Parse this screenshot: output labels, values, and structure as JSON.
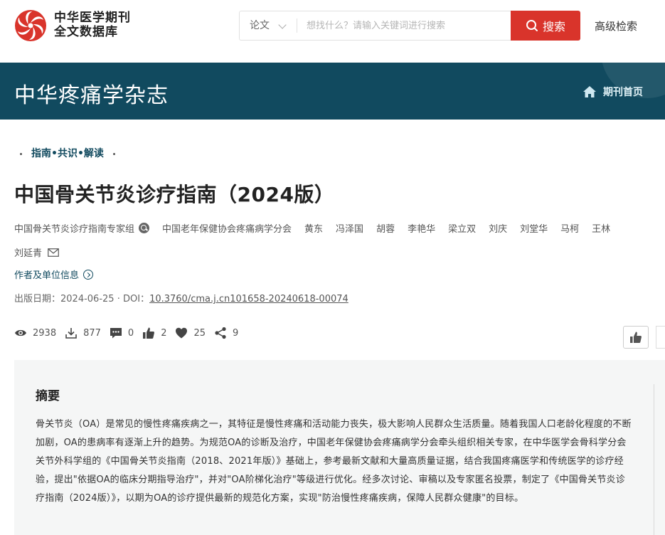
{
  "header": {
    "logo_line1": "中华医学期刊",
    "logo_line2": "全文数据库",
    "search_type": "论文",
    "search_placeholder": "想找什么？请输入关键词进行搜索",
    "search_button": "搜索",
    "advanced_search": "高级检索",
    "brand_color": "#d9342b"
  },
  "banner": {
    "journal_title": "中华疼痛学杂志",
    "home_link": "期刊首页",
    "bg_color": "#114a5f"
  },
  "article": {
    "category": "指南•共识•解读",
    "title": "中国骨关节炎诊疗指南（2024版）",
    "author_group": "中国骨关节炎诊疗指南专家组",
    "authors": [
      "中国老年保健协会疼痛病学分会",
      "黄东",
      "冯泽国",
      "胡蓉",
      "李艳华",
      "梁立双",
      "刘庆",
      "刘堂华",
      "马柯",
      "王林"
    ],
    "corresponding_author": "刘延青",
    "affiliation_link": "作者及单位信息",
    "pub_date_label": "出版日期：",
    "pub_date": "2024-06-25",
    "doi_label": " · DOI：",
    "doi": "10.3760/cma.j.cn101658-20240618-00074",
    "stats": {
      "views": "2938",
      "downloads": "877",
      "comments": "0",
      "likes": "2",
      "favorites": "25",
      "shares": "9"
    }
  },
  "abstract": {
    "heading": "摘要",
    "text": "骨关节炎（OA）是常见的慢性疼痛疾病之一，其特征是慢性疼痛和活动能力丧失，极大影响人民群众生活质量。随着我国人口老龄化程度的不断加剧，OA的患病率有逐渐上升的趋势。为规范OA的诊断及治疗，中国老年保健协会疼痛病学分会牵头组织相关专家，在中华医学会骨科学分会关节外科学组的《中国骨关节炎指南（2018、2021年版）》基础上，参考最新文献和大量高质量证据，结合我国疼痛医学和传统医学的诊疗经验，提出\"依据OA的临床分期指导治疗\"，并对\"OA阶梯化治疗\"等级进行优化。经多次讨论、审稿以及专家匿名投票，制定了《中国骨关节炎诊疗指南（2024版）》，以期为OA的诊疗提供最新的规范化方案，实现\"防治慢性疼痛疾病，保障人民群众健康\"的目标。"
  }
}
